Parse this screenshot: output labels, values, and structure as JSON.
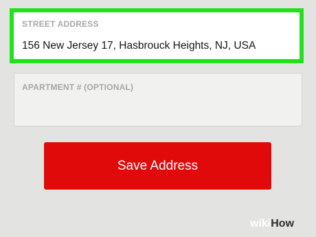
{
  "colors": {
    "background": "#e3e3e1",
    "focus_border": "#22e21c",
    "save_button_bg": "#e10a0a",
    "label_text": "#a7a7a7"
  },
  "street_address": {
    "label": "STREET ADDRESS",
    "value": "156 New Jersey 17, Hasbrouck Heights, NJ, USA"
  },
  "apartment": {
    "label": "APARTMENT # (OPTIONAL)",
    "value": ""
  },
  "save_button": {
    "label": "Save Address"
  },
  "watermark": {
    "part1": "wiki",
    "part2": "How"
  }
}
